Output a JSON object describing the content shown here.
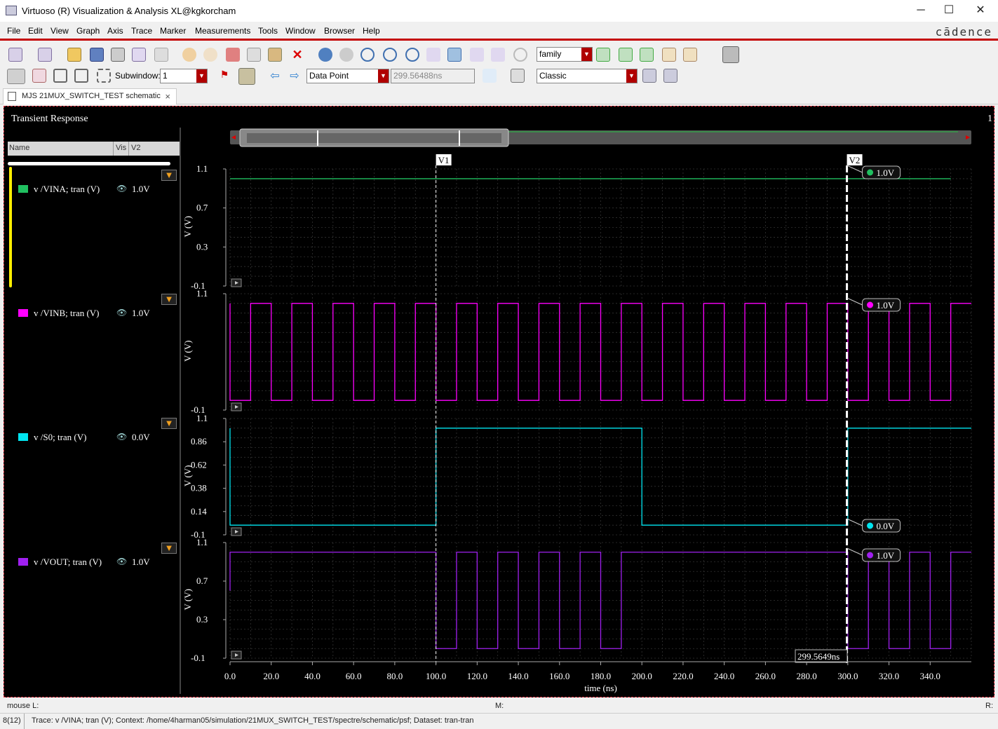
{
  "window": {
    "title": "Virtuoso (R) Visualization & Analysis XL@kgkorcham",
    "minimize": "─",
    "maximize": "☐",
    "close": "✕"
  },
  "menu": [
    "File",
    "Edit",
    "View",
    "Graph",
    "Axis",
    "Trace",
    "Marker",
    "Measurements",
    "Tools",
    "Window",
    "Browser",
    "Help"
  ],
  "logo": "cādence",
  "toolbar": {
    "family_select": "family",
    "subwindow_label": "Subwindow:",
    "subwindow_value": "1",
    "marker_type": "Data Point",
    "marker_value": "299.56488ns",
    "style_select": "Classic"
  },
  "tab": {
    "label": "MJS 21MUX_SWITCH_TEST schematic",
    "close": "×"
  },
  "plot": {
    "title": "Transient Response",
    "subwindow_number": "1",
    "legend_header": {
      "name": "Name",
      "vis": "Vis",
      "v2": "V2"
    },
    "traces": [
      {
        "name": "v /VINA; tran (V)",
        "value": "1.0V",
        "color": "#20c060"
      },
      {
        "name": "v /VINB; tran (V)",
        "value": "1.0V",
        "color": "#ff00ff"
      },
      {
        "name": "v /S0; tran (V)",
        "value": "0.0V",
        "color": "#00e5f0"
      },
      {
        "name": "v /VOUT; tran (V)",
        "value": "1.0V",
        "color": "#a020f0"
      }
    ],
    "markers": {
      "v1_label": "V1",
      "v1_time_ns": 100,
      "v2_label": "V2",
      "v2_time_ns": 299.5649,
      "v2_readout": "299.5649ns"
    },
    "xlabel": "time (ns)",
    "ylabel": "V (V)"
  },
  "chart_data": [
    {
      "type": "line",
      "title": "",
      "series": [
        {
          "name": "v /VINA; tran (V)",
          "x": [
            0,
            350
          ],
          "y": [
            1.0,
            1.0
          ]
        }
      ],
      "xlim": [
        0,
        360
      ],
      "ylim": [
        -0.1,
        1.1
      ],
      "yticks": [
        "1.1",
        "0.7",
        "0.3",
        "-0.1"
      ],
      "ylabel": "V (V)"
    },
    {
      "type": "line",
      "title": "",
      "series": [
        {
          "name": "v /VINB; tran (V)",
          "period_ns": 20,
          "high_ns": 10,
          "first_rise_ns": 10,
          "low": 0.0,
          "high": 1.0,
          "x_range": [
            0,
            360
          ]
        }
      ],
      "xlim": [
        0,
        360
      ],
      "ylim": [
        -0.1,
        1.1
      ],
      "yticks": [
        "1.1",
        "-0.1"
      ],
      "ylabel": "V (V)"
    },
    {
      "type": "line",
      "title": "",
      "series": [
        {
          "name": "v /S0; tran (V)",
          "x": [
            0,
            0,
            100,
            100,
            200,
            200,
            300,
            300,
            360
          ],
          "y": [
            1.0,
            0.0,
            0.0,
            1.0,
            1.0,
            0.0,
            0.0,
            1.0,
            1.0
          ]
        }
      ],
      "xlim": [
        0,
        360
      ],
      "ylim": [
        -0.1,
        1.1
      ],
      "yticks": [
        "1.1",
        "0.86",
        "0.62",
        "0.38",
        "0.14",
        "-0.1"
      ],
      "ylabel": "V (V)"
    },
    {
      "type": "line",
      "title": "",
      "series": [
        {
          "name": "v /VOUT; tran (V)",
          "description_segments": [
            {
              "from": 0,
              "to": 100,
              "value": 1.0
            },
            {
              "from": 100,
              "to": 200,
              "follows": "VINB"
            },
            {
              "from": 200,
              "to": 300,
              "value": 1.0
            },
            {
              "from": 300,
              "to": 360,
              "follows": "VINB"
            }
          ]
        }
      ],
      "xlim": [
        0,
        360
      ],
      "ylim": [
        -0.1,
        1.1
      ],
      "yticks": [
        "1.1",
        "0.7",
        "0.3",
        "-0.1"
      ],
      "ylabel": "V (V)"
    }
  ],
  "xticks": [
    "0.0",
    "20.0",
    "40.0",
    "60.0",
    "80.0",
    "100.0",
    "120.0",
    "140.0",
    "160.0",
    "180.0",
    "200.0",
    "220.0",
    "240.0",
    "260.0",
    "280.0",
    "300.0",
    "320.0",
    "340.0"
  ],
  "status": {
    "mouse": "mouse L:",
    "middle": "M:",
    "right": "R:"
  },
  "bottom": {
    "counter": "8(12)",
    "message": "Trace: v /VINA; tran (V); Context: /home/4harman05/simulation/21MUX_SWITCH_TEST/spectre/schematic/psf; Dataset: tran-tran"
  }
}
